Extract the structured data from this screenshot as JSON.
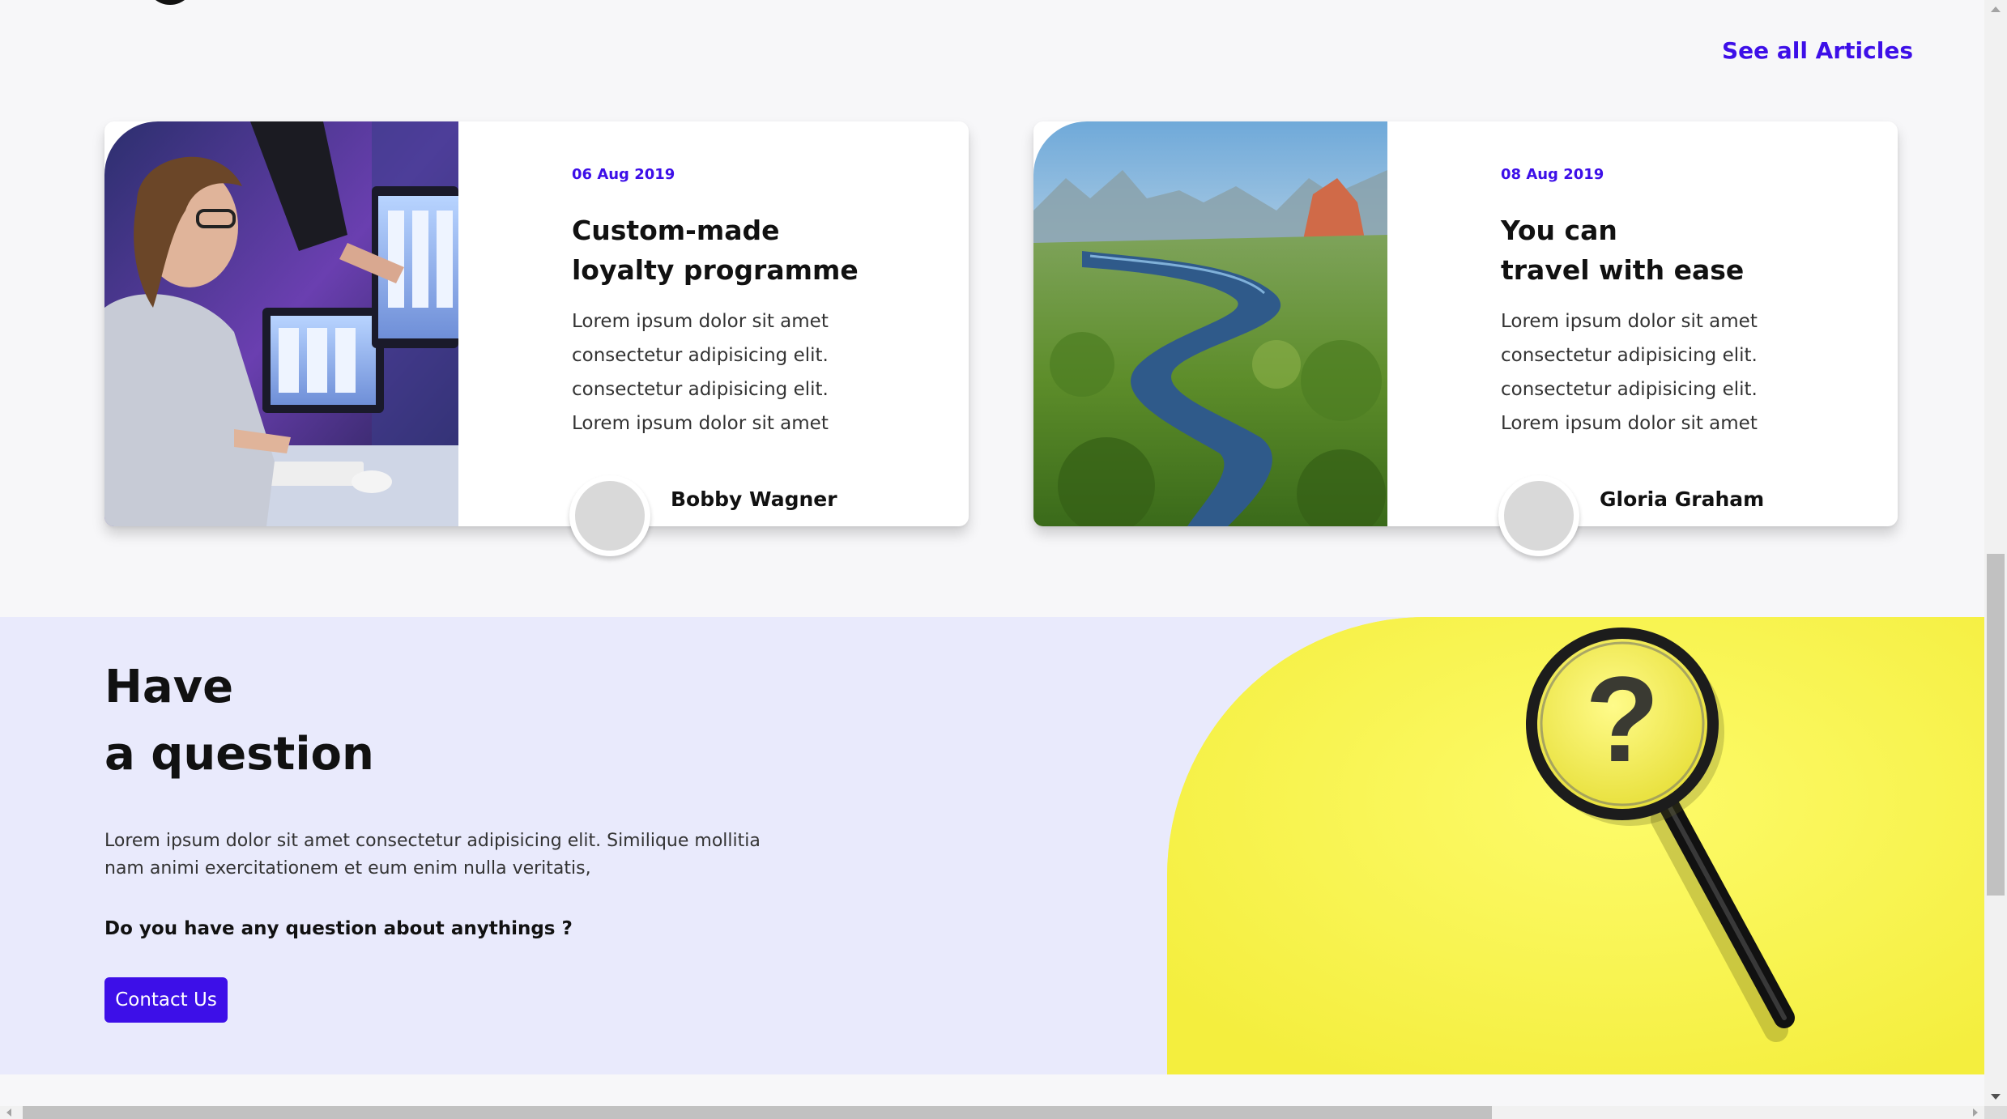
{
  "articles_section": {
    "see_all_label": "See all Articles",
    "accent_color": "#3d0fe8",
    "cards": [
      {
        "image_icon": "designer-at-monitors-photo",
        "date": "06 Aug 2019",
        "title": "Custom-made\nloyalty programme",
        "text_lines": [
          "Lorem ipsum dolor sit amet",
          "consectetur adipisicing elit.",
          "consectetur adipisicing elit.",
          "Lorem ipsum dolor sit amet"
        ],
        "author": "Bobby Wagner"
      },
      {
        "image_icon": "river-landscape-photo",
        "date": "08 Aug 2019",
        "title": "You can\ntravel with ease",
        "text_lines": [
          "Lorem ipsum dolor sit amet",
          "consectetur adipisicing elit.",
          "consectetur adipisicing elit.",
          "Lorem ipsum dolor sit amet"
        ],
        "author": "Gloria Graham"
      }
    ]
  },
  "question_section": {
    "title_lines": [
      "Have",
      "a question"
    ],
    "description": "Lorem ipsum dolor sit amet consectetur adipisicing elit. Similique mollitia nam animi exercitationem et eum enim nulla veritatis,",
    "ask": "Do you have any question about anythings ?",
    "button_label": "Contact Us",
    "image_icon": "magnifying-glass-question-photo",
    "background_color": "#e9eafc",
    "image_background": "#fbf855"
  }
}
